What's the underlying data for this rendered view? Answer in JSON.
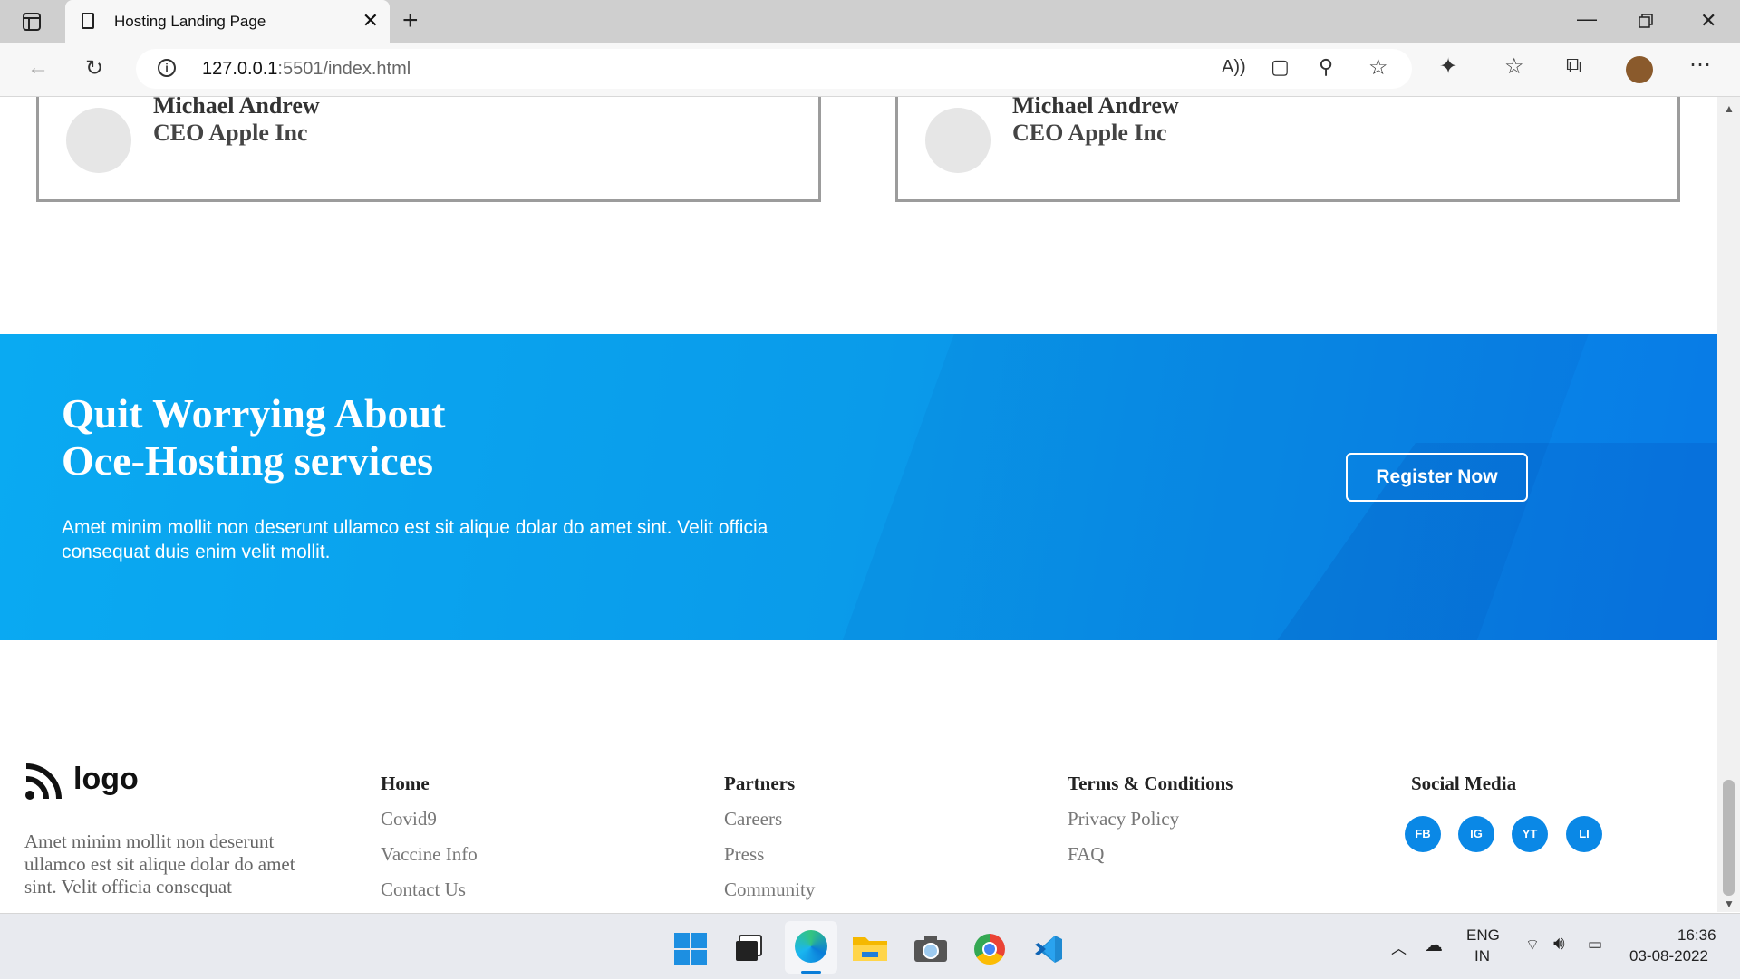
{
  "browser": {
    "tab_title": "Hosting Landing Page",
    "url_host": "127.0.0.1",
    "url_rest": ":5501/index.html"
  },
  "testimonials": [
    {
      "name": "Michael Andrew",
      "role": "CEO Apple Inc"
    },
    {
      "name": "Michael Andrew",
      "role": "CEO Apple Inc"
    }
  ],
  "cta": {
    "title_line1": "Quit Worrying About",
    "title_line2": "Oce-Hosting services",
    "description": "Amet minim mollit non deserunt ullamco est sit alique dolar do amet sint. Velit officia consequat duis enim velit mollit.",
    "button": "Register Now"
  },
  "footer": {
    "logo_text": "logo",
    "description": "Amet minim mollit non deserunt ullamco est sit alique dolar do amet sint. Velit officia consequat",
    "columns": [
      {
        "heading": "Home",
        "links": [
          "Covid9",
          "Vaccine Info",
          "Contact Us"
        ]
      },
      {
        "heading": "Partners",
        "links": [
          "Careers",
          "Press",
          "Community"
        ]
      },
      {
        "heading": "Terms & Conditions",
        "links": [
          "Privacy Policy",
          "FAQ"
        ]
      }
    ],
    "social_heading": "Social Media",
    "social": [
      "FB",
      "IG",
      "YT",
      "LI"
    ]
  },
  "taskbar": {
    "lang1": "ENG",
    "lang2": "IN",
    "time": "16:36",
    "date": "03-08-2022"
  },
  "colors": {
    "cta_start": "#0aaaf2",
    "cta_end": "#087ae6",
    "social": "#0a88e6"
  }
}
